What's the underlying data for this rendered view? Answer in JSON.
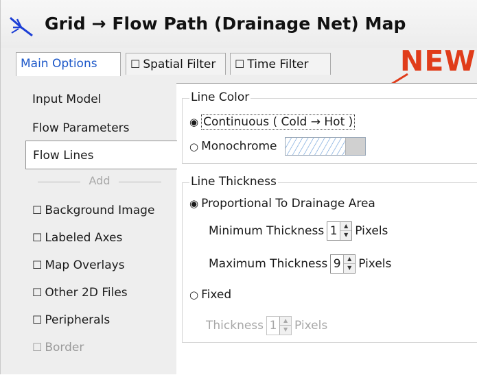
{
  "window": {
    "title": "Grid → Flow Path (Drainage Net) Map"
  },
  "tabs": [
    {
      "label": "Main Options",
      "checkbox": "",
      "active": true
    },
    {
      "label": "Spatial Filter",
      "checkbox": "☐",
      "active": false
    },
    {
      "label": "Time Filter",
      "checkbox": "☐",
      "active": false
    }
  ],
  "annotation": {
    "new_label": "NEW",
    "color": "#e03c1a"
  },
  "leftnav": {
    "items": [
      {
        "label": "Input Model"
      },
      {
        "label": "Flow Parameters"
      },
      {
        "label": "Flow Lines"
      }
    ],
    "add_separator": "Add",
    "add_items": [
      {
        "label": "Background Image",
        "checkbox": "☐"
      },
      {
        "label": "Labeled Axes",
        "checkbox": "☐"
      },
      {
        "label": "Map Overlays",
        "checkbox": "☐"
      },
      {
        "label": "Other 2D Files",
        "checkbox": "☐"
      },
      {
        "label": "Peripherals",
        "checkbox": "☐"
      },
      {
        "label": "Border",
        "checkbox": "☐"
      }
    ]
  },
  "line_color": {
    "title": "Line Color",
    "continuous": {
      "label": "Continuous ( Cold → Hot )",
      "radio": "◉",
      "selected": true
    },
    "monochrome": {
      "label": "Monochrome",
      "radio": "○",
      "selected": false
    }
  },
  "line_thickness": {
    "title": "Line Thickness",
    "proportional": {
      "label": "Proportional To Drainage Area",
      "radio": "◉",
      "selected": true
    },
    "minimum": {
      "label": "Minimum Thickness",
      "value": "1",
      "unit": "Pixels"
    },
    "maximum": {
      "label": "Maximum Thickness",
      "value": "9",
      "unit": "Pixels"
    },
    "fixed": {
      "label": "Fixed",
      "radio": "○",
      "selected": false
    },
    "thickness": {
      "label": "Thickness",
      "value": "1",
      "unit": "Pixels"
    }
  },
  "icons": {
    "spin_up": "▲",
    "spin_down": "▼"
  }
}
